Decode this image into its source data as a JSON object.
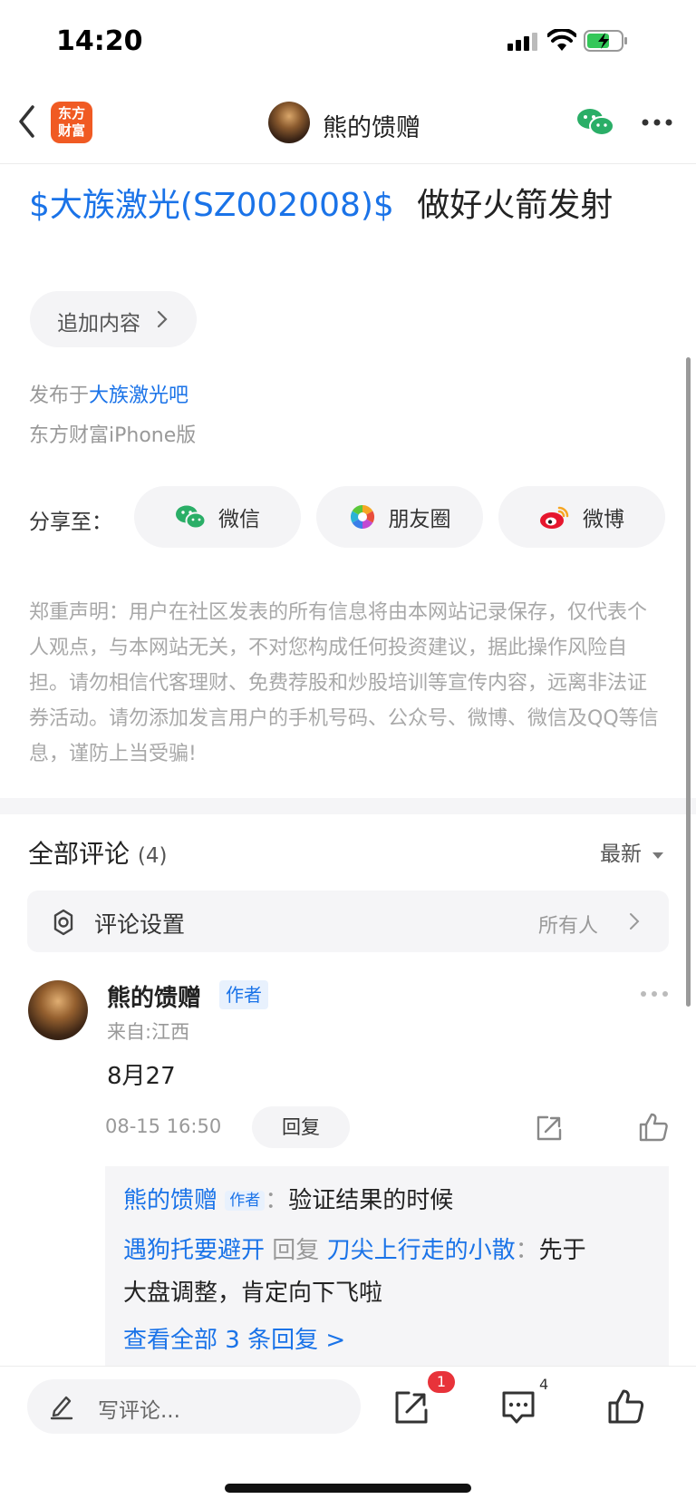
{
  "status_bar": {
    "time": "14:20"
  },
  "nav": {
    "logo_text_line1": "东方",
    "logo_text_line2": "财富",
    "title": "熊的馈赠",
    "icons": [
      "back-icon",
      "wechat-icon",
      "more-icon"
    ]
  },
  "post": {
    "stock_link": "$大族激光(SZ002008)$",
    "text": "做好火箭发射",
    "add_content_label": "追加内容",
    "published_prefix": "发布于",
    "published_link": "大族激光吧",
    "client": "东方财富iPhone版"
  },
  "share": {
    "label": "分享至：",
    "items": [
      {
        "label": "微信",
        "icon": "wechat-icon"
      },
      {
        "label": "朋友圈",
        "icon": "moments-icon"
      },
      {
        "label": "微博",
        "icon": "weibo-icon"
      }
    ]
  },
  "disclaimer": "郑重声明：用户在社区发表的所有信息将由本网站记录保存，仅代表个人观点，与本网站无关，不对您构成任何投资建议，据此操作风险自担。请勿相信代客理财、免费荐股和炒股培训等宣传内容，远离非法证券活动。请勿添加发言用户的手机号码、公众号、微博、微信及QQ等信息，谨防上当受骗!",
  "comments": {
    "title": "全部评论",
    "count": "(4)",
    "sort": "最新",
    "settings_label": "评论设置",
    "settings_value": "所有人",
    "items": [
      {
        "name": "熊的馈赠",
        "tag": "作者",
        "from": "来自:江西",
        "body": "8月27",
        "time": "08-15 16:50",
        "reply_label": "回复",
        "replies": [
          {
            "name": "熊的馈赠",
            "tag": "作者",
            "sep": "：",
            "text": "验证结果的时候"
          },
          {
            "name": "遇狗托要避开",
            "reply_word": "回复",
            "target": "刀尖上行走的小散",
            "sep": "：",
            "text": "先于",
            "text_cont": "大盘调整，肯定向下飞啦"
          }
        ],
        "view_all": "查看全部 3 条回复 >"
      }
    ]
  },
  "bottom_bar": {
    "comment_placeholder": "写评论...",
    "share_badge": "1",
    "comment_count": "4"
  }
}
